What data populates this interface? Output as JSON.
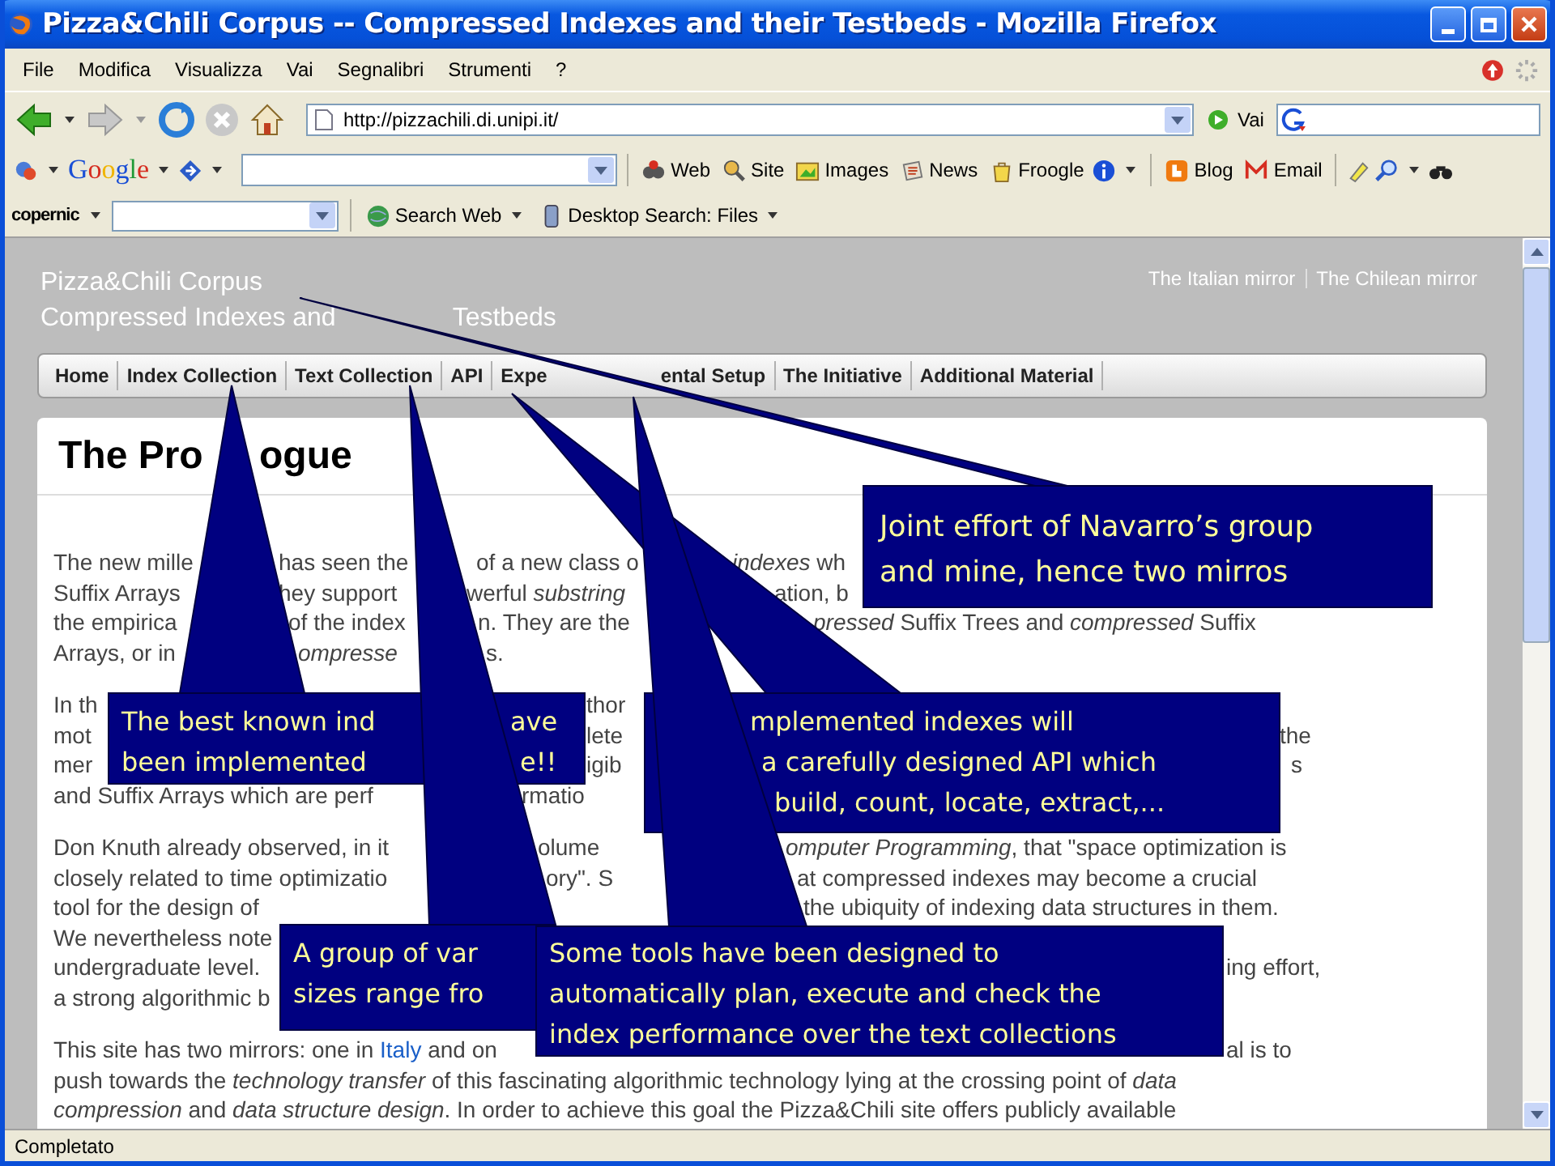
{
  "window": {
    "title": "Pizza&Chili Corpus -- Compressed Indexes and their Testbeds - Mozilla Firefox"
  },
  "menu": [
    "File",
    "Modifica",
    "Visualizza",
    "Vai",
    "Segnalibri",
    "Strumenti",
    "?"
  ],
  "navigation_toolbar": {
    "url": "http://pizzachili.di.unipi.it/",
    "go_label": "Vai"
  },
  "google_toolbar": {
    "logo": "Google",
    "buttons": [
      {
        "kind": "web",
        "label": "Web"
      },
      {
        "kind": "site",
        "label": "Site"
      },
      {
        "kind": "images",
        "label": "Images"
      },
      {
        "kind": "news",
        "label": "News"
      },
      {
        "kind": "froogle",
        "label": "Froogle"
      },
      {
        "kind": "blog",
        "label": "Blog"
      },
      {
        "kind": "email",
        "label": "Email"
      }
    ]
  },
  "copernic_toolbar": {
    "logo": "copernic",
    "buttons": [
      "Search Web",
      "Desktop Search: Files"
    ]
  },
  "page": {
    "site_title": "Pizza&Chili Corpus",
    "site_subtitle": [
      "Compressed Indexes and",
      "Testbeds"
    ],
    "mirrors": [
      "The Italian mirror",
      "The Chilean mirror"
    ],
    "nav": [
      {
        "parts": [
          "Home"
        ]
      },
      {
        "parts": [
          "Index Collection"
        ]
      },
      {
        "parts": [
          "Text Collection"
        ]
      },
      {
        "parts": [
          "API"
        ]
      },
      {
        "parts": [
          "Expe",
          "ental Setup"
        ]
      },
      {
        "parts": [
          "The Initiative"
        ]
      },
      {
        "parts": [
          "Additional Material"
        ]
      }
    ],
    "heading": [
      "The Pro",
      "ogue"
    ],
    "paragraphs": [
      [
        [
          "The new mille",
          "has seen the",
          "of a new class o",
          "*indexes* wh"
        ],
        [
          "Suffix Arrays",
          "hey support",
          "werful *substring*",
          "ation, b"
        ],
        [
          "the empirica",
          "of the index",
          "n. They are the",
          "*pressed* Suffix Trees and *compressed* Suffix"
        ],
        [
          "Arrays, or in",
          "*ompresse*",
          "s."
        ]
      ],
      [
        [
          "In th",
          "thor"
        ],
        [
          "mot",
          "lete",
          "the"
        ],
        [
          "mer",
          "igib",
          "s"
        ],
        [
          "and Suffix Arrays which are perf",
          "rmatio"
        ]
      ],
      [
        [
          "Don Knuth already observed, in it",
          "olume",
          "*omputer Programming*, that \"space optimization is"
        ],
        [
          "closely related to time optimizatio",
          "ory\". S",
          "at compressed indexes may become a crucial"
        ],
        [
          "tool for the design of",
          "the ubiquity of indexing data structures in them."
        ],
        [
          "We nevertheless note"
        ],
        [
          "undergraduate level.",
          "ing effort,"
        ],
        [
          "a strong algorithmic b"
        ]
      ],
      [
        [
          [
            {
              "kind": "text",
              "text": "This site has two mirrors: one in "
            },
            {
              "kind": "link",
              "text": "Italy"
            },
            {
              "kind": "text",
              "text": " and on"
            }
          ],
          "al is to"
        ],
        [
          "push towards the *technology transfer* of this fascinating algorithmic technology lying at the crossing point of *data*"
        ],
        [
          "*compression* and *data structure design*. In order to achieve this goal the Pizza&Chili site offers publicly available"
        ]
      ]
    ]
  },
  "callouts": [
    {
      "lines": [
        [
          "Joint effort of Navarro’s group"
        ],
        [
          "and mine, hence two mirros"
        ]
      ]
    },
    {
      "lines": [
        [
          "The best known ind",
          "ave"
        ],
        [
          "been implemented",
          "e!!"
        ]
      ]
    },
    {
      "lines": [
        [
          "mplemented indexes will"
        ],
        [
          "a carefully designed API which"
        ],
        [
          "build, count, locate, extract,..."
        ]
      ]
    },
    {
      "lines": [
        [
          "A group of var"
        ],
        [
          "sizes range fro"
        ]
      ]
    },
    {
      "lines": [
        [
          "Some tools have been designed to"
        ],
        [
          "automatically plan, execute and check the"
        ],
        [
          "index performance over the text collections"
        ]
      ]
    }
  ],
  "status_bar": "Completato"
}
